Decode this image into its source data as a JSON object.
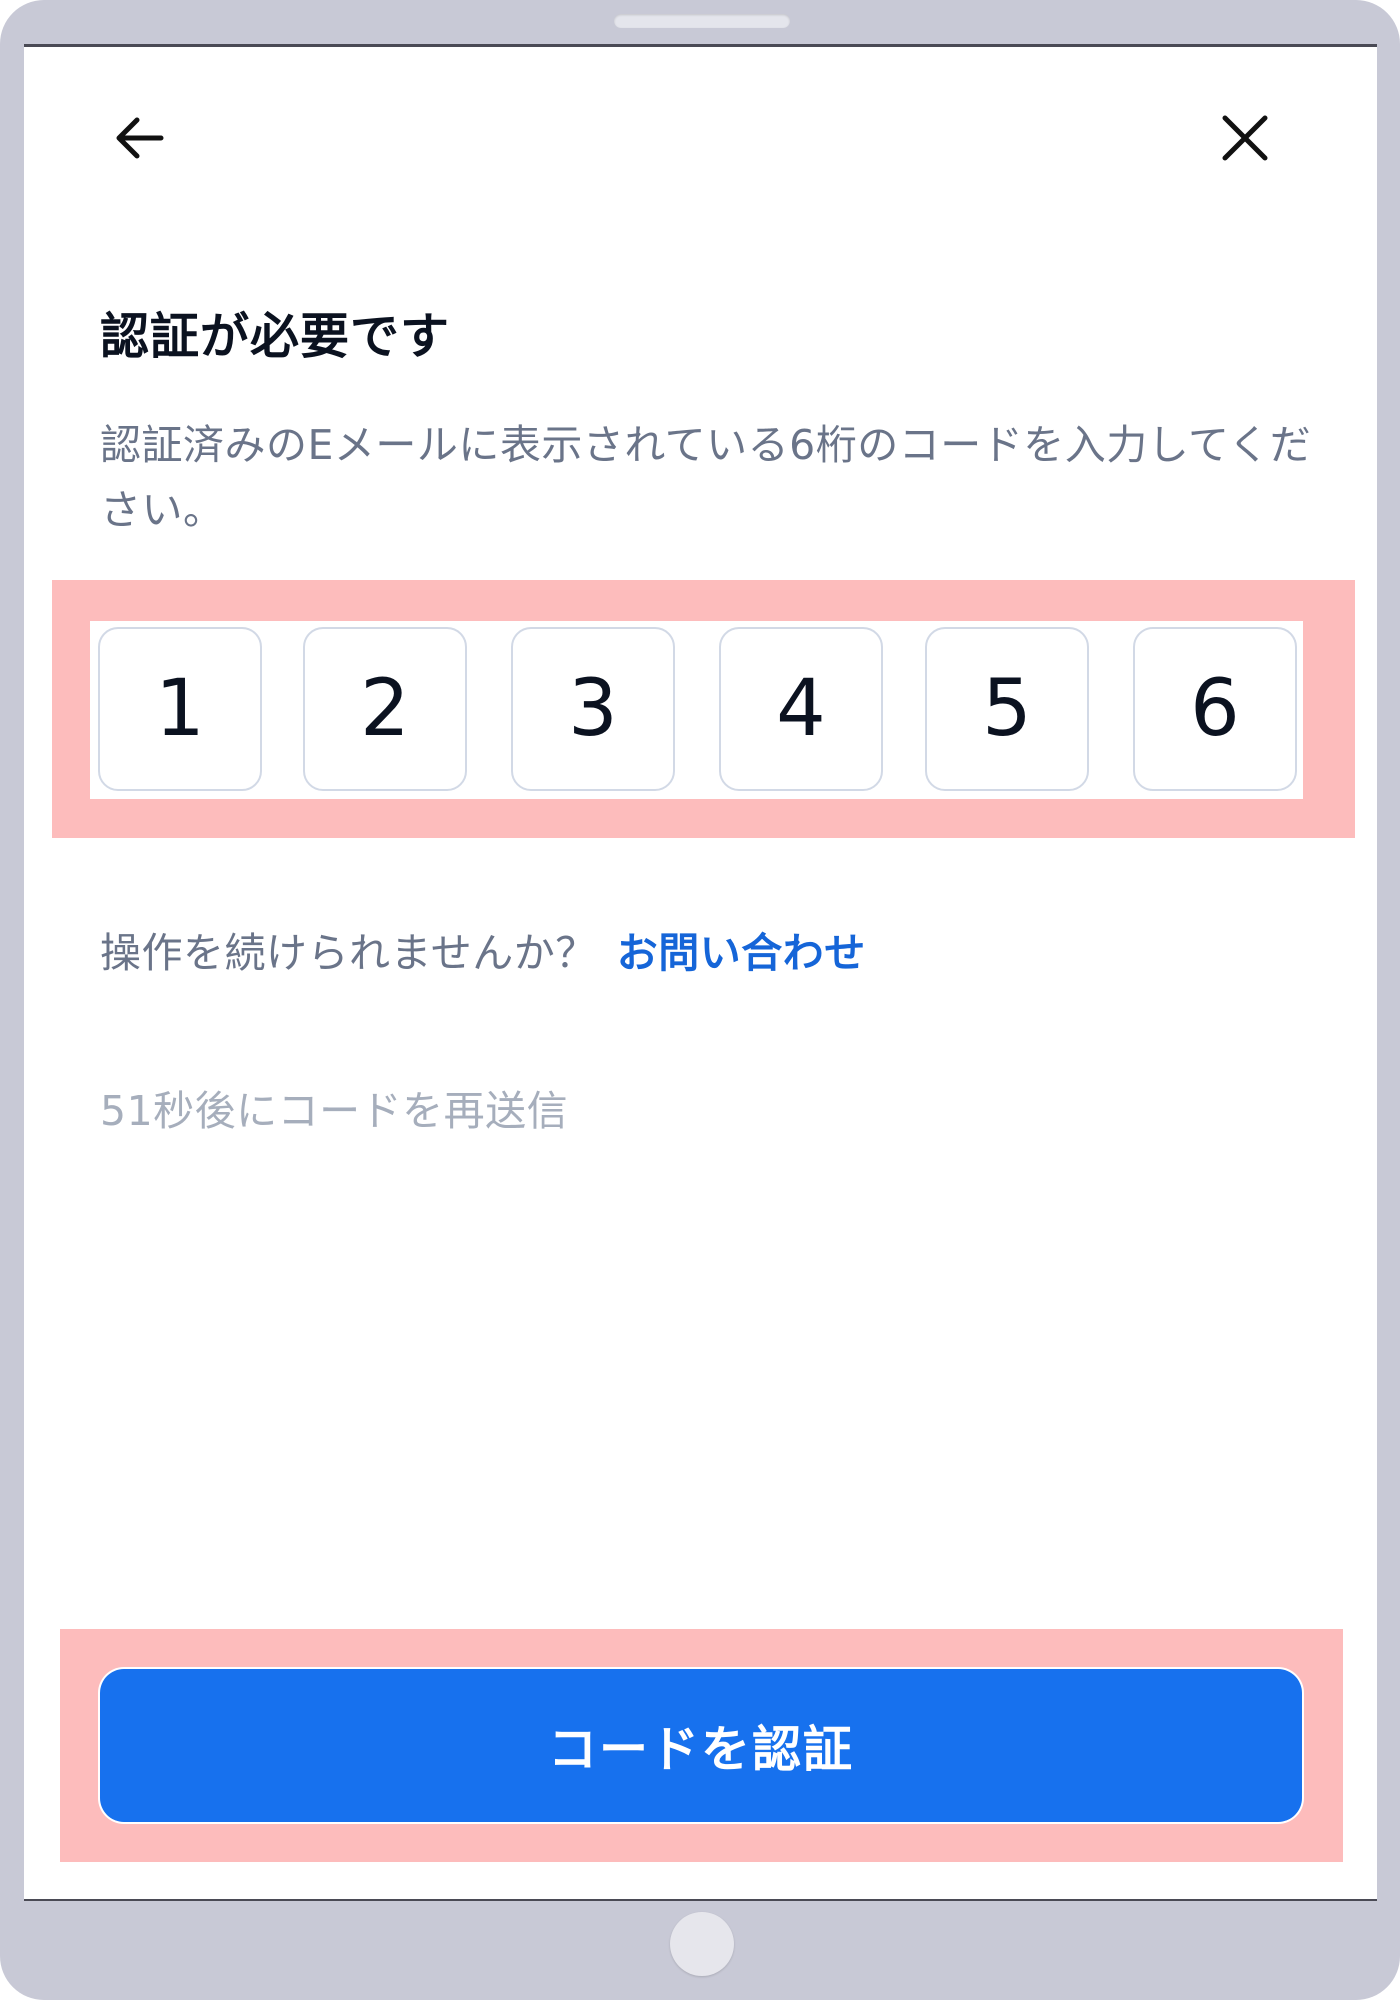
{
  "header": {
    "back_icon": "arrow-left-icon",
    "close_icon": "close-icon"
  },
  "verification": {
    "title": "認証が必要です",
    "description": "認証済みのEメールに表示されている6桁のコードを入力してください。",
    "code_digits": [
      "1",
      "2",
      "3",
      "4",
      "5",
      "6"
    ],
    "help_text": "操作を続けられませんか？",
    "help_link": "お問い合わせ",
    "resend_text": "51秒後にコードを再送信",
    "submit_label": "コードを認証"
  },
  "colors": {
    "primary_button": "#1771ee",
    "link": "#1565d8",
    "highlight": "#fdbcbc",
    "title_text": "#0b1220",
    "secondary_text": "#6a7489",
    "muted_text": "#a6aebc",
    "device_frame": "#c8c9d6"
  }
}
